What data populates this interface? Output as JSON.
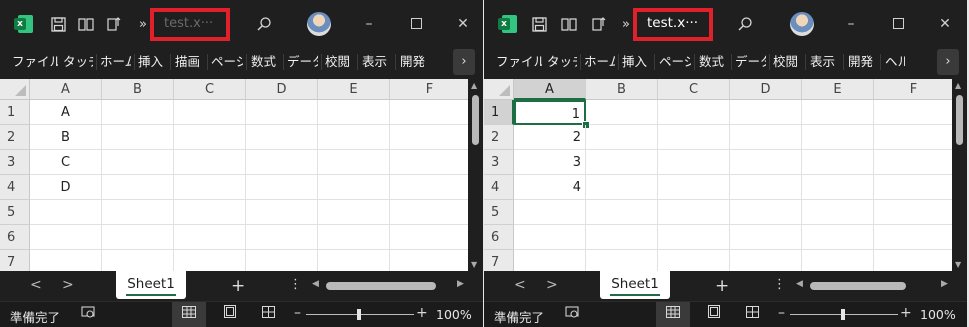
{
  "left": {
    "title": "test.x···",
    "ribbon_tabs": [
      "ファイル",
      "タッチ",
      "ホーム",
      "挿入",
      "描画",
      "ページ",
      "数式",
      "データ",
      "校閲",
      "表示",
      "開発"
    ],
    "columns": [
      "A",
      "B",
      "C",
      "D",
      "E",
      "F"
    ],
    "rows": [
      "1",
      "2",
      "3",
      "4",
      "5",
      "6",
      "7"
    ],
    "col_a": [
      "A",
      "B",
      "C",
      "D",
      "",
      "",
      ""
    ],
    "sheet": "Sheet1",
    "status": "準備完了",
    "zoom": "100%"
  },
  "right": {
    "title": "test.x···",
    "ribbon_tabs": [
      "ファイル",
      "タッチ",
      "ホーム",
      "挿入",
      "ページ",
      "数式",
      "データ",
      "校閲",
      "表示",
      "開発",
      "ヘルプ"
    ],
    "columns": [
      "A",
      "B",
      "C",
      "D",
      "E",
      "F"
    ],
    "rows": [
      "1",
      "2",
      "3",
      "4",
      "5",
      "6",
      "7"
    ],
    "col_a": [
      "1",
      "2",
      "3",
      "4",
      "",
      "",
      ""
    ],
    "sheet": "Sheet1",
    "status": "準備完了",
    "zoom": "100%"
  },
  "icons": {
    "overflow_chevron": "»",
    "ribbon_more": "›",
    "nav_left": "<",
    "nav_right": ">",
    "add_sheet": "+",
    "more_options": "⋮",
    "minimize": "–",
    "maximize": "☐",
    "close": "✕",
    "zoom_minus": "–",
    "zoom_plus": "+"
  },
  "colors": {
    "highlight_box": "#e0202a",
    "excel_green": "#107c41",
    "selection_green": "#1e6e43"
  }
}
